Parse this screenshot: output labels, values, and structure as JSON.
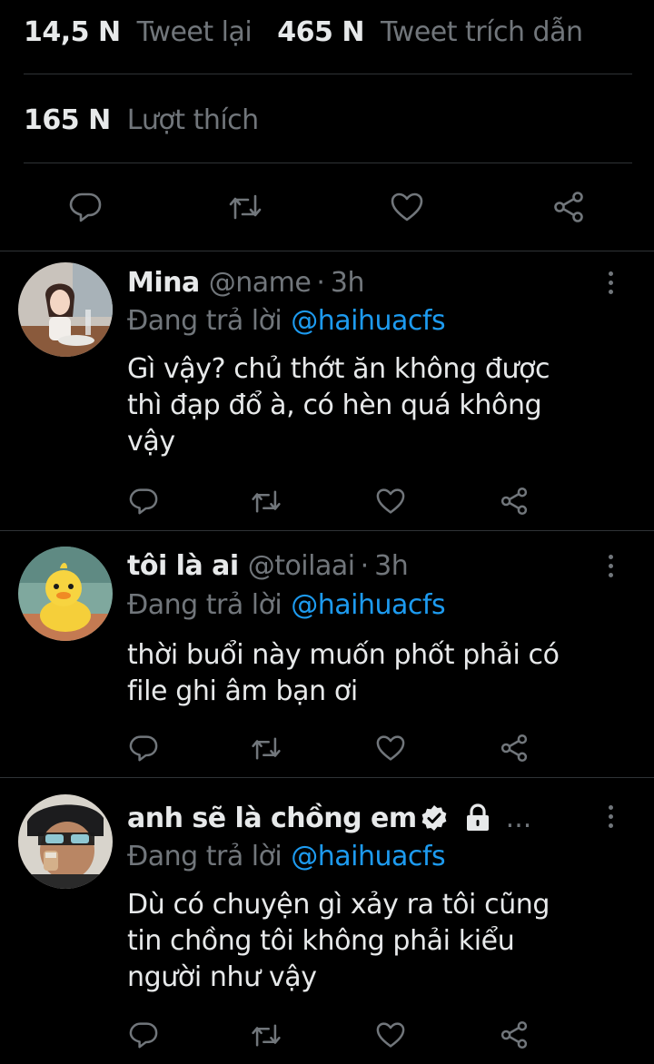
{
  "stats": {
    "retweets_count": "14,5 N",
    "retweets_label": "Tweet lại",
    "quotes_count": "465 N",
    "quotes_label": "Tweet trích dẫn",
    "likes_count": "165 N",
    "likes_label": "Lượt thích"
  },
  "colors": {
    "background": "#000000",
    "text": "#e7e9ea",
    "muted": "#71767b",
    "link": "#1d9bf0",
    "divider": "#2f3336"
  },
  "main_actions": [
    "reply-icon",
    "retweet-icon",
    "like-icon",
    "share-icon"
  ],
  "replies": [
    {
      "name": "Mina",
      "handle": "@name",
      "separator": "·",
      "time": "3h",
      "replying_label": "Đang trả lời",
      "replying_to": "@haihuacfs",
      "lines": [
        "Gì vậy? chủ thớt ăn không được",
        "thì đạp đổ à, có hèn quá không",
        "vậy"
      ]
    },
    {
      "name": "tôi là ai",
      "handle": "@toilaai",
      "separator": "·",
      "time": "3h",
      "replying_label": "Đang trả lời",
      "replying_to": "@haihuacfs",
      "lines": [
        "thời buổi này muốn phốt phải có",
        "file ghi âm bạn ơi"
      ]
    },
    {
      "name": "anh sẽ là chồng em",
      "verified": true,
      "protected": true,
      "ellipsis": "...",
      "replying_label": "Đang trả lời",
      "replying_to": "@haihuacfs",
      "lines": [
        "Dù có chuyện gì xảy ra tôi cũng",
        "tin chồng tôi không phải kiểu",
        "người như vậy"
      ]
    }
  ]
}
